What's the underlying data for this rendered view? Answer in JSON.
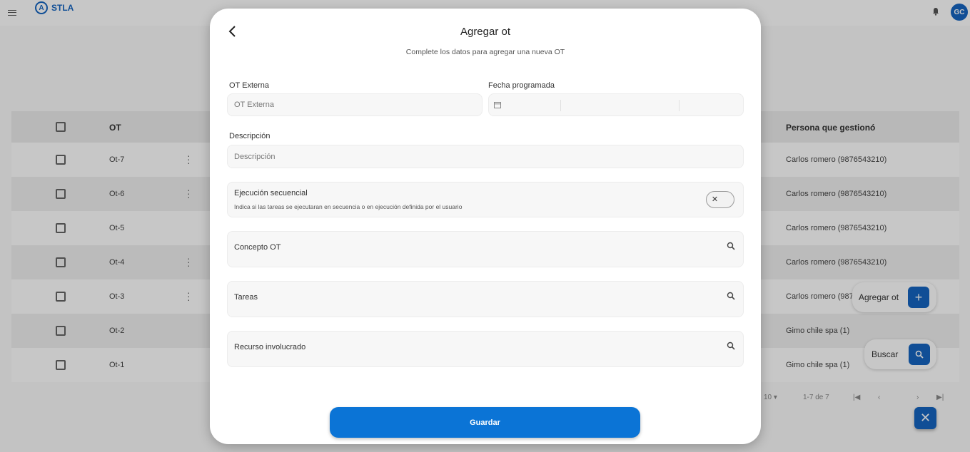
{
  "app": {
    "logo_text": "STLA",
    "logo_mark": "A",
    "avatar_initials": "GC"
  },
  "table": {
    "headers": {
      "ot": "OT",
      "persona": "Persona que gestionó"
    },
    "rows": [
      {
        "ot": "Ot-7",
        "persona": "Carlos romero  (9876543210)",
        "menu": true
      },
      {
        "ot": "Ot-6",
        "persona": "Carlos romero  (9876543210)",
        "menu": true
      },
      {
        "ot": "Ot-5",
        "persona": "Carlos romero  (9876543210)",
        "menu": false
      },
      {
        "ot": "Ot-4",
        "persona": "Carlos romero  (9876543210)",
        "menu": true
      },
      {
        "ot": "Ot-3",
        "persona": "Carlos romero  (987",
        "menu": true
      },
      {
        "ot": "Ot-2",
        "persona": "Gimo chile spa (1)",
        "menu": false
      },
      {
        "ot": "Ot-1",
        "persona": "Gimo chile spa (1)",
        "menu": false
      }
    ]
  },
  "pagination": {
    "page_size": "10 ▾",
    "range": "1-7 de 7",
    "first": "|◀",
    "prev": "‹",
    "next": "›",
    "last": "▶|"
  },
  "fabs": {
    "add_label": "Agregar ot",
    "add_icon": "+",
    "search_label": "Buscar",
    "close_icon": "✕"
  },
  "modal": {
    "title": "Agregar ot",
    "subtitle": "Complete los datos para agregar una nueva OT",
    "ot_externa": {
      "label": "OT Externa",
      "placeholder": "OT Externa",
      "value": ""
    },
    "fecha": {
      "label": "Fecha programada"
    },
    "descripcion": {
      "label": "Descripción",
      "placeholder": "Descripción",
      "value": ""
    },
    "secuencial": {
      "title": "Ejecución secuencial",
      "description": "Indica si las tareas se ejecutaran en secuencia o en ejecución definida por el usuario",
      "toggle_icon": "✕"
    },
    "concepto": {
      "label": "Concepto OT"
    },
    "tareas": {
      "label": "Tareas"
    },
    "recurso": {
      "label": "Recurso involucrado"
    },
    "save_label": "Guardar"
  },
  "colors": {
    "primary": "#1565c0",
    "button": "#0b74d6"
  }
}
